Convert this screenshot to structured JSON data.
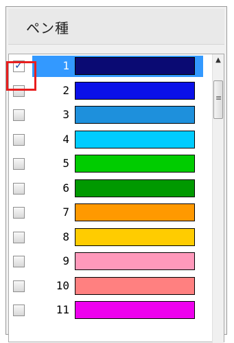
{
  "panel": {
    "title": "ペン種"
  },
  "scrollbar": {
    "up_arrow": "▲",
    "grip": "≡"
  },
  "checkmark": "✓",
  "pens": [
    {
      "number": "1",
      "color": "#0a0a73",
      "checked": true,
      "selected": true
    },
    {
      "number": "2",
      "color": "#0a10e8",
      "checked": false,
      "selected": false
    },
    {
      "number": "3",
      "color": "#1e90dc",
      "checked": false,
      "selected": false
    },
    {
      "number": "4",
      "color": "#00ccff",
      "checked": false,
      "selected": false
    },
    {
      "number": "5",
      "color": "#00cc00",
      "checked": false,
      "selected": false
    },
    {
      "number": "6",
      "color": "#009900",
      "checked": false,
      "selected": false
    },
    {
      "number": "7",
      "color": "#ff9900",
      "checked": false,
      "selected": false
    },
    {
      "number": "8",
      "color": "#ffcc00",
      "checked": false,
      "selected": false
    },
    {
      "number": "9",
      "color": "#ff99bb",
      "checked": false,
      "selected": false
    },
    {
      "number": "10",
      "color": "#ff8080",
      "checked": false,
      "selected": false
    },
    {
      "number": "11",
      "color": "#ee00ee",
      "checked": false,
      "selected": false
    }
  ],
  "colors": {
    "selection": "#3399ff",
    "highlight_border": "#e81e1e"
  }
}
